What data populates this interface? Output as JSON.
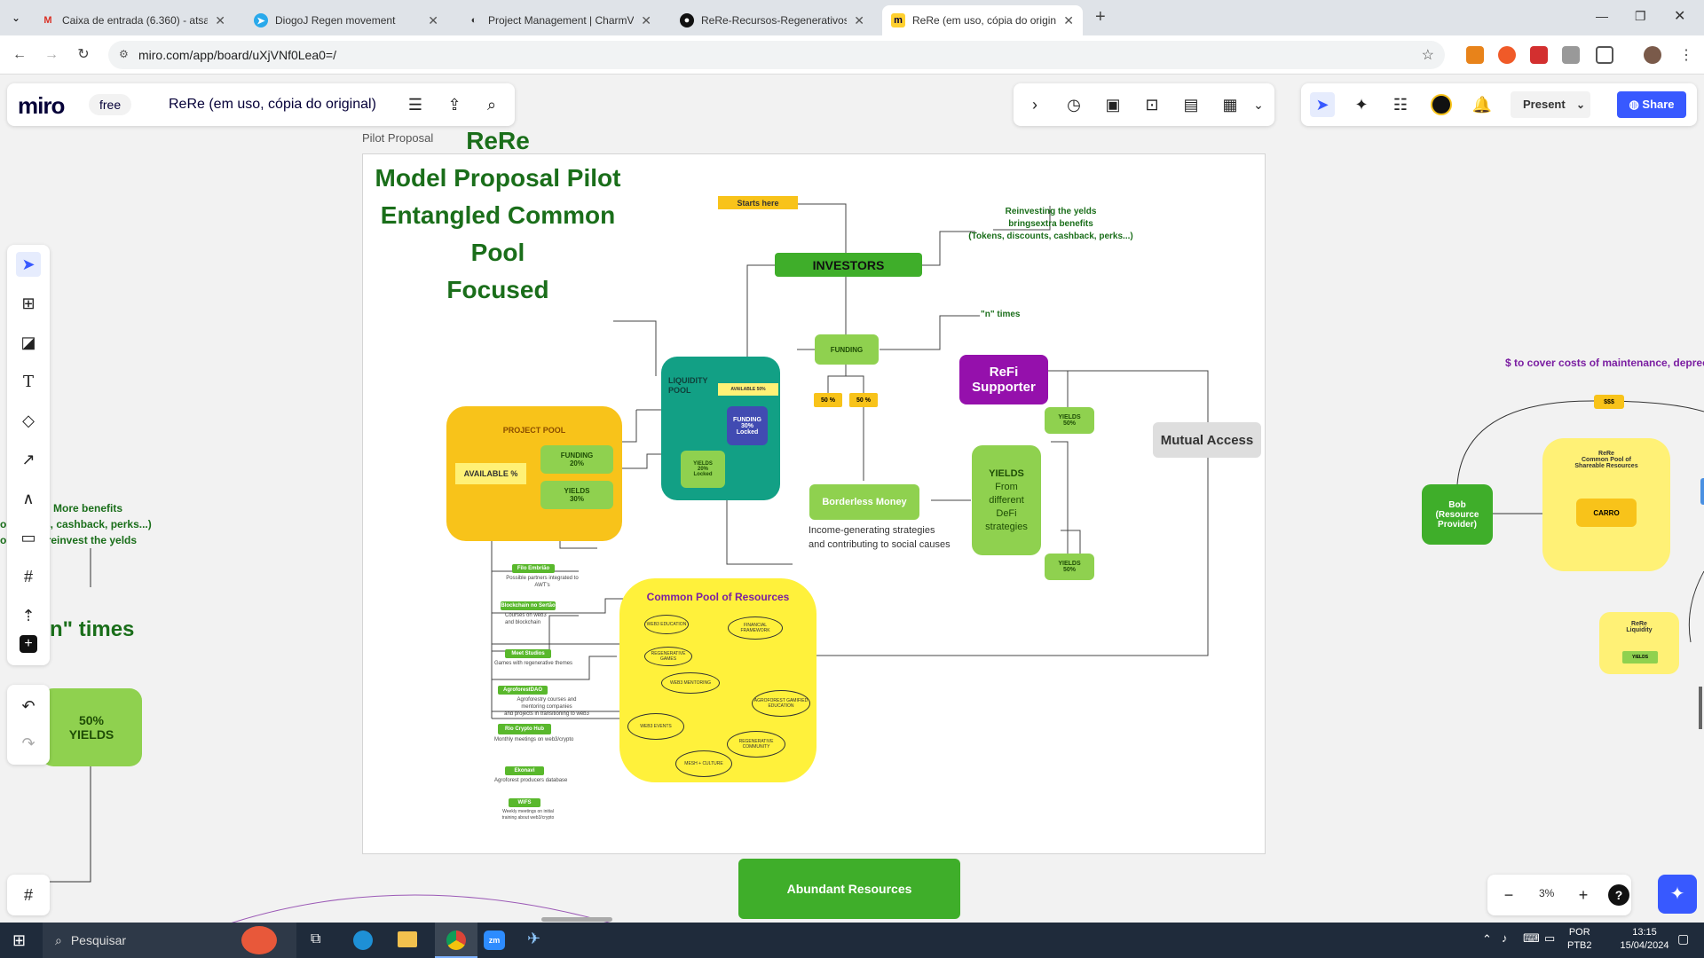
{
  "browser": {
    "tabs": [
      {
        "title": "Caixa de entrada (6.360) - atsa...",
        "icon": "gmail-icon"
      },
      {
        "title": "DiogoJ Regen movement",
        "icon": "telegram-icon"
      },
      {
        "title": "Project Management | CharmVe...",
        "icon": "charmverse-icon"
      },
      {
        "title": "ReRe-Recursos-Regenerativos/(...",
        "icon": "github-icon"
      },
      {
        "title": "ReRe (em uso, cópia do original)",
        "icon": "miro-icon"
      }
    ],
    "url": "miro.com/app/board/uXjVNf0Lea0=/"
  },
  "miro": {
    "logo": "miro",
    "plan": "free",
    "board_title": "ReRe (em uso, cópia do original)",
    "present": "Present",
    "share": "Share",
    "zoom": "3%",
    "help": "?"
  },
  "board": {
    "frame_label": "Pilot Proposal",
    "title_lines": [
      "ReRe",
      "Model Proposal Pilot",
      "Entangled Common Pool",
      "Focused"
    ],
    "starts_here": "Starts here",
    "investors": "INVESTORS",
    "reinvest": [
      "Reinvesting the yelds",
      "bringsextra benefits",
      "(Tokens, discounts, cashback, perks...)"
    ],
    "n_times": "\"n\" times",
    "funding": "FUNDING",
    "refi": [
      "ReFi",
      "Supporter"
    ],
    "liquidity": {
      "title": [
        "LIQUIDITY",
        "POOL"
      ],
      "available": "AVAILABLE 50%",
      "locked": [
        "FUNDING",
        "30%",
        "Locked"
      ],
      "yields": [
        "YIELDS",
        "20%",
        "Locked"
      ]
    },
    "pct_a": "50 %",
    "pct_b": "50 %",
    "project_pool": {
      "title": "PROJECT POOL",
      "available": "AVAILABLE %",
      "funding": [
        "FUNDING",
        "20%"
      ],
      "yields": [
        "YIELDS",
        "30%"
      ]
    },
    "yields_50_a": [
      "YIELDS",
      "50%"
    ],
    "yields_50_b": [
      "YIELDS",
      "50%"
    ],
    "yields_defi": [
      "YIELDS",
      "From",
      "different",
      "DeFi",
      "strategies"
    ],
    "borderless": "Borderless Money",
    "borderless_desc": [
      "Income-generating strategies",
      "and contributing to social causes"
    ],
    "mutual": "Mutual Access",
    "common_pool": "Common Pool of Resources",
    "ovals": [
      "WEB3 EDUCATION",
      "FINANCIAL FRAMEWORK",
      "REGENERATIVE GAMES",
      "WEB3 MENTORING",
      "AGROFOREST GAMIFIED EDUCATION",
      "WEB3 EVENTS",
      "REGENERATIVE COMMUNITY",
      "MESH + CULTURE"
    ],
    "partners": [
      {
        "name": "Filo Embrião",
        "desc": "Possible partners integrated to",
        "desc2": "AWT’s"
      },
      {
        "name": "Blockchain no Sertão",
        "desc": "Courses on web3",
        "desc2": "and blockchain"
      },
      {
        "name": "Meet Studios",
        "desc": "Games with regenerative themes",
        "desc2": ""
      },
      {
        "name": "AgroforestDAO",
        "desc": "Agroforestry courses and",
        "desc2": "mentoring companies"
      },
      {
        "name": "Rio Crypto Hub",
        "desc": "Monthly meetings on web3/crypto",
        "desc2": ""
      },
      {
        "name": "Ekonavi",
        "desc": "Agroforest producers database",
        "desc2": ""
      },
      {
        "name": "WIFS",
        "desc": "Weekly meetings on initial",
        "desc2": "training about web3/crypto"
      }
    ],
    "agro_desc3": "and projects in transitioning to web3",
    "abundant": "Abundant Resources",
    "left_cut": {
      "more_benefits": "More benefits",
      "line2": "scounts, cashback, perks...)",
      "line3": "rs who reinvest the yelds",
      "times": "n\" times",
      "yields": [
        "50%",
        "YIELDS"
      ]
    },
    "right_cut": {
      "costs": "$ to cover costs of maintenance, deprecia",
      "sss": "$$$",
      "bob": [
        "Bob",
        "(Resource",
        "Provider)"
      ],
      "shareable": [
        "ReRe",
        "Common Pool of",
        "Shareable Resources"
      ],
      "carro": "CARRO",
      "liquidity": [
        "ReRe",
        "Liquidity"
      ],
      "yields_small": "YIELDS"
    }
  },
  "taskbar": {
    "search": "Pesquisar",
    "lang1": "POR",
    "lang2": "PTB2",
    "time": "13:15",
    "date": "15/04/2024"
  },
  "colors": {
    "green": "#59b82c",
    "light_green": "#8fd14f",
    "yellow": "#fff176",
    "orange": "#f8c31a",
    "teal": "#12a085",
    "purple": "#9510ac",
    "title_green": "#1a6e1a"
  }
}
